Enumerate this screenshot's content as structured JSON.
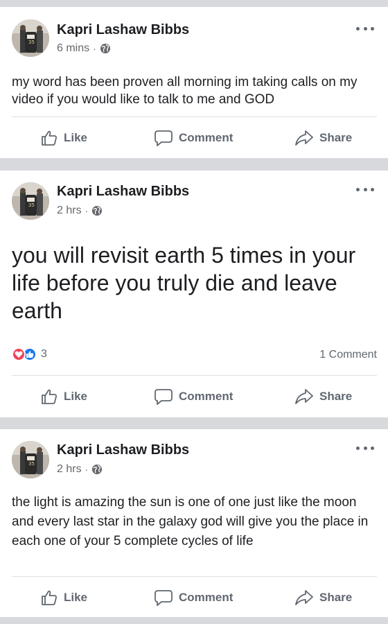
{
  "posts": [
    {
      "author": "Kapri Lashaw Bibbs",
      "time": "6 mins",
      "text": "my word has been proven all morning im taking calls on my video if you would like to talk to me and GOD"
    },
    {
      "author": "Kapri Lashaw Bibbs",
      "time": "2 hrs",
      "text": "you will revisit earth 5 times in your life before you truly die and leave earth",
      "reaction_count": "3",
      "comment_count": "1 Comment"
    },
    {
      "author": "Kapri Lashaw Bibbs",
      "time": "2 hrs",
      "text": "the light is amazing the sun is one of one just like the moon and every last star in the galaxy god will give you the place in each one of your 5 complete cycles of life"
    }
  ],
  "actions": {
    "like": "Like",
    "comment": "Comment",
    "share": "Share"
  },
  "separator": "·",
  "colors": {
    "page_bg": "#d8d9dd",
    "card_bg": "#ffffff",
    "secondary_text": "#65676b",
    "like_blue": "#1877f2",
    "love_red": "#f33e58"
  }
}
